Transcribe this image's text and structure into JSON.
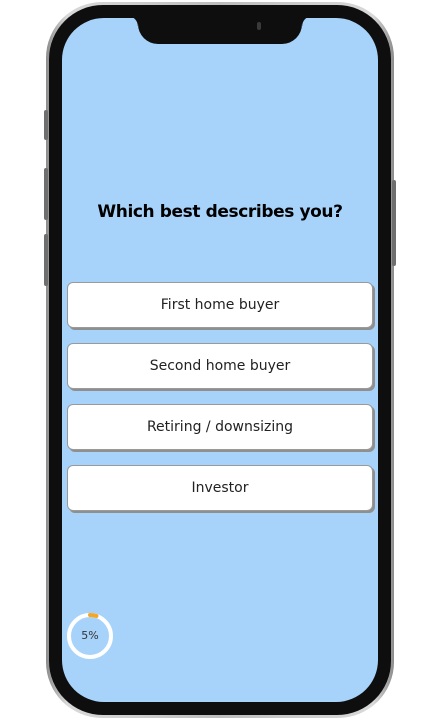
{
  "screen": {
    "background": "#a7d3fb"
  },
  "question": {
    "title": "Which best describes you?"
  },
  "options": [
    {
      "label": "First home buyer"
    },
    {
      "label": "Second home buyer"
    },
    {
      "label": "Retiring / downsizing"
    },
    {
      "label": "Investor"
    }
  ],
  "progress": {
    "label": "5%",
    "value": 0.05,
    "ring_color": "#ffffff",
    "fill_color": "#f5a623"
  }
}
